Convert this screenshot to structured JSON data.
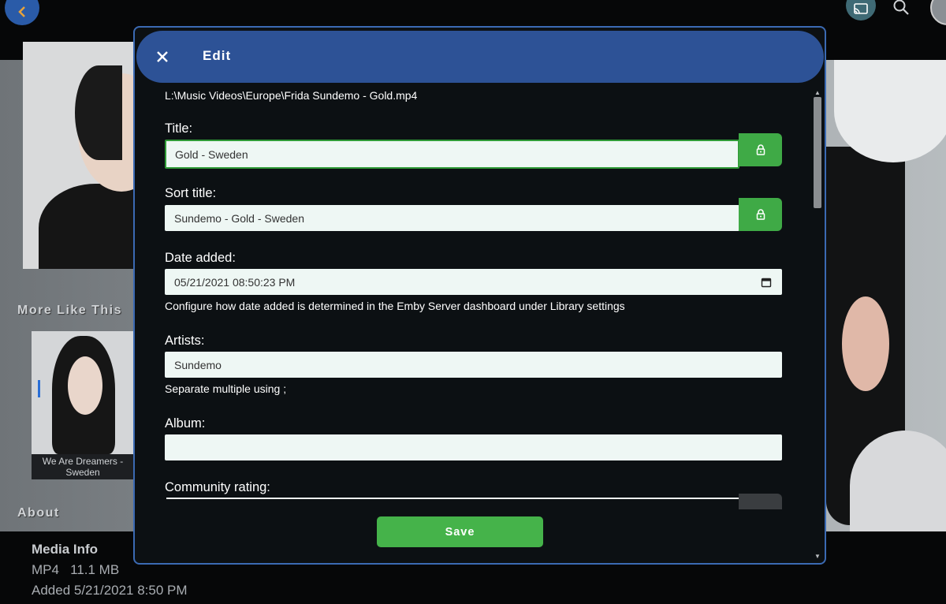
{
  "background": {
    "more_like_this": "More Like This",
    "thumb_caption": "We Are Dreamers - Sweden",
    "about": "About",
    "media_info_title": "Media Info",
    "media_format_size": "MP4   11.1 MB",
    "media_added": "Added 5/21/2021 8:50 PM"
  },
  "dialog": {
    "title": "Edit",
    "file_path": "L:\\Music Videos\\Europe\\Frida Sundemo - Gold.mp4",
    "fields": {
      "title": {
        "label": "Title:",
        "value": "Gold - Sweden"
      },
      "sort_title": {
        "label": "Sort title:",
        "value": "Sundemo - Gold - Sweden"
      },
      "date_added": {
        "label": "Date added:",
        "value": "05/21/2021 08:50:23 PM",
        "hint": "Configure how date added is determined in the Emby Server dashboard under Library settings"
      },
      "artists": {
        "label": "Artists:",
        "value": "Sundemo",
        "hint": "Separate multiple using ;"
      },
      "album": {
        "label": "Album:",
        "value": ""
      },
      "community_rating": {
        "label": "Community rating:"
      }
    },
    "save_label": "Save"
  },
  "colors": {
    "header": "#2d5296",
    "accent_green": "#45b34a",
    "field_bg": "#eef7f4"
  }
}
